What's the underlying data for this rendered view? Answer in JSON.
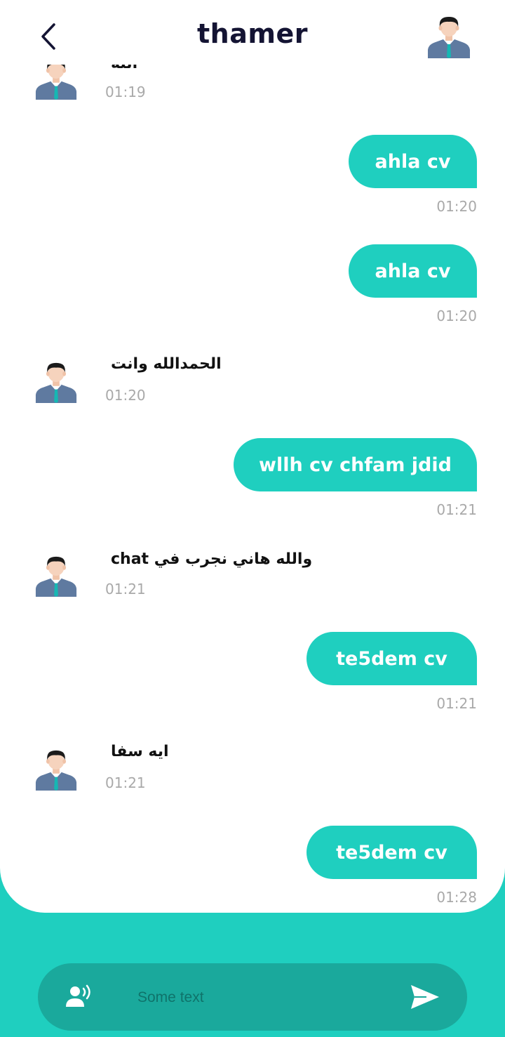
{
  "header": {
    "title": "thamer",
    "back_icon": "chevron-left-icon",
    "contact_avatar_icon": "person-avatar-icon"
  },
  "messages": [
    {
      "side": "received",
      "text": "الله",
      "time": "01:19",
      "clipped": true
    },
    {
      "side": "sent",
      "text": "ahla cv",
      "time": "01:20"
    },
    {
      "side": "sent",
      "text": "ahla cv",
      "time": "01:20"
    },
    {
      "side": "received",
      "text": "الحمدالله وانت",
      "time": "01:20"
    },
    {
      "side": "sent",
      "text": "wllh cv chfam jdid",
      "time": "01:21"
    },
    {
      "side": "received",
      "text": "والله هاني نجرب في chat",
      "time": "01:21"
    },
    {
      "side": "sent",
      "text": "te5dem cv",
      "time": "01:21"
    },
    {
      "side": "received",
      "text": "ايه سفا",
      "time": "01:21"
    },
    {
      "side": "sent",
      "text": "te5dem cv",
      "time": "01:28"
    }
  ],
  "composer": {
    "placeholder": "Some text",
    "value": "",
    "voice_icon": "voice-speak-icon",
    "send_icon": "send-arrow-icon"
  },
  "colors": {
    "accent": "#1fcfbf",
    "input_bar": "#1aa99c",
    "title": "#141433",
    "timestamp": "#a9a9a9"
  }
}
